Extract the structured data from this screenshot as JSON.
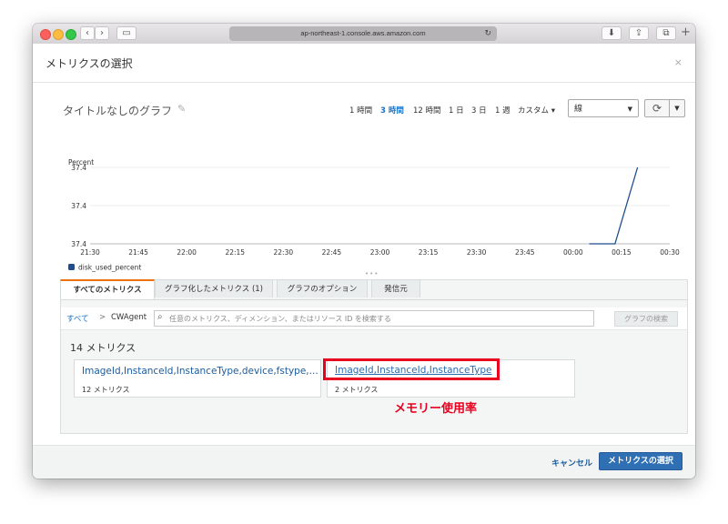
{
  "browser": {
    "url": "ap-northeast-1.console.aws.amazon.com"
  },
  "modal": {
    "title": "メトリクスの選択",
    "close": "×"
  },
  "graph": {
    "title": "タイトルなしのグラフ",
    "time_ranges": [
      "1 時間",
      "3 時間",
      "12 時間",
      "1 日",
      "3 日",
      "1 週",
      "カスタム ▾"
    ],
    "active_range": "3 時間",
    "view_select": "線"
  },
  "chart_data": {
    "type": "line",
    "ylabel": "Percent",
    "y_ticks": [
      "37.4",
      "37.4",
      "37.4"
    ],
    "x": [
      "21:30",
      "21:45",
      "22:00",
      "22:15",
      "22:30",
      "22:45",
      "23:00",
      "23:15",
      "23:30",
      "23:45",
      "00:00",
      "00:15",
      "00:30"
    ],
    "series": [
      {
        "name": "disk_used_percent",
        "color": "#1f4e8c",
        "points": [
          {
            "x": "00:05",
            "y": 0.0
          },
          {
            "x": "00:13",
            "y": 0.0
          },
          {
            "x": "00:20",
            "y": 1.0
          }
        ]
      }
    ],
    "grid": true,
    "legend": "bottom-left"
  },
  "tabs": {
    "items": [
      "すべてのメトリクス",
      "グラフ化したメトリクス (1)",
      "グラフのオプション",
      "発信元"
    ],
    "active": 0
  },
  "browse": {
    "crumb_all": "すべて",
    "crumb_sep": ">",
    "crumb_current": "CWAgent",
    "search_placeholder": "任意のメトリクス、ディメンション、またはリソース ID を検索する",
    "search_button": "グラフの検索",
    "metrics_count": "14 メトリクス",
    "namespaces": [
      {
        "label": "ImageId,InstanceId,InstanceType,device,fstype,...",
        "count": "12 メトリクス"
      },
      {
        "label": "ImageId,InstanceId,InstanceType",
        "count": "2 メトリクス"
      }
    ],
    "annotation": "メモリー使用率"
  },
  "footer": {
    "cancel": "キャンセル",
    "select": "メトリクスの選択"
  }
}
